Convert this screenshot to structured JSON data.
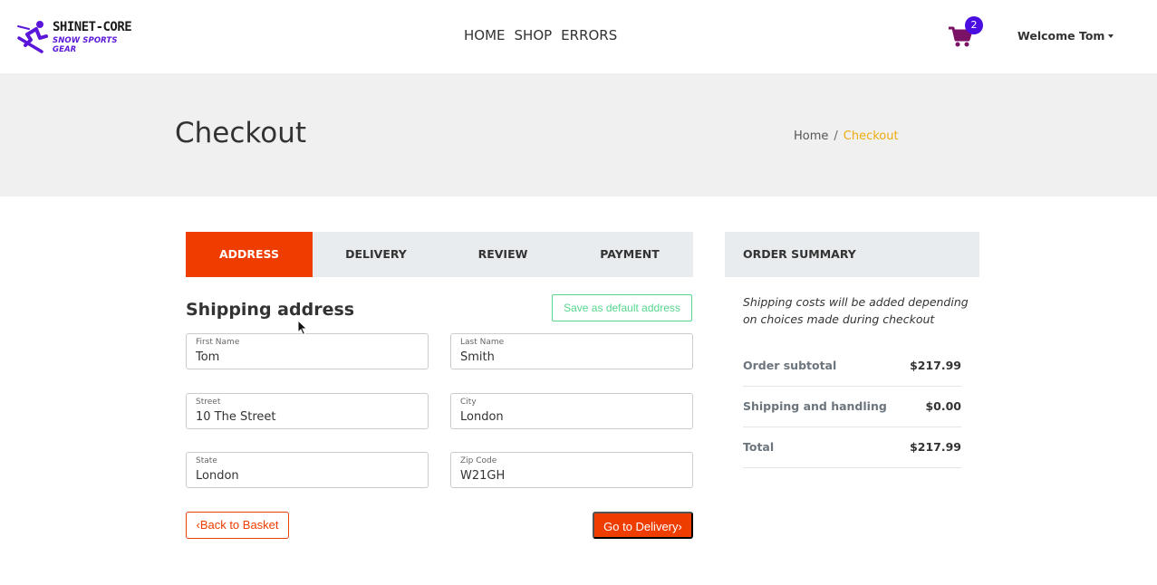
{
  "brand": {
    "title": "SHINET-CORE",
    "subtitle": "SNOW SPORTS GEAR",
    "icon": "skier-icon",
    "accent_color": "#5b17d9"
  },
  "nav": {
    "links": [
      "HOME",
      "SHOP",
      "ERRORS"
    ],
    "cart_count": "2",
    "welcome": "Welcome Tom"
  },
  "hero": {
    "title": "Checkout",
    "breadcrumb": {
      "home": "Home",
      "separator": "/",
      "current": "Checkout"
    }
  },
  "steps": {
    "items": [
      "ADDRESS",
      "DELIVERY",
      "REVIEW",
      "PAYMENT"
    ],
    "active": "ADDRESS"
  },
  "shipping": {
    "title": "Shipping address",
    "save_default": "Save as default address",
    "fields": {
      "first_name": {
        "label": "First Name",
        "value": "Tom"
      },
      "last_name": {
        "label": "Last Name",
        "value": "Smith"
      },
      "street": {
        "label": "Street",
        "value": "10 The Street"
      },
      "city": {
        "label": "City",
        "value": "London"
      },
      "state": {
        "label": "State",
        "value": "London"
      },
      "zip": {
        "label": "Zip Code",
        "value": "W21GH"
      }
    },
    "back_label": "Back to Basket",
    "next_label": "Go to Delivery"
  },
  "summary": {
    "title": "ORDER SUMMARY",
    "note": "Shipping costs will be added depending on choices made during checkout",
    "rows": [
      {
        "label": "Order subtotal",
        "value": "$217.99"
      },
      {
        "label": "Shipping and handling",
        "value": "$0.00"
      },
      {
        "label": "Total",
        "value": "$217.99"
      }
    ]
  },
  "colors": {
    "primary": "#ef3d00",
    "breadcrumb_active": "#f0ab0e",
    "success_outline": "#57d68d",
    "badge": "#4a0ee0",
    "cart_icon": "#7a1266"
  }
}
